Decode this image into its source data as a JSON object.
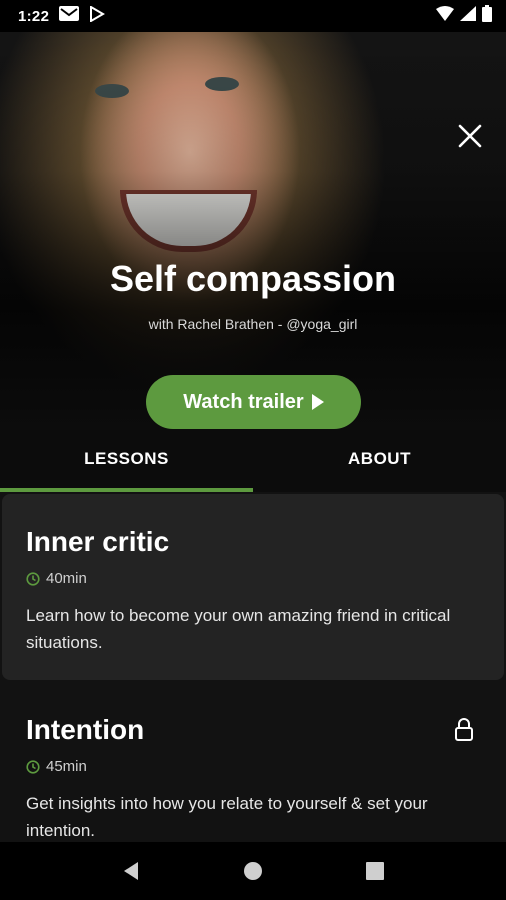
{
  "status_bar": {
    "time": "1:22",
    "left_icons": [
      "gmail-icon",
      "play-store-icon"
    ],
    "right_icons": [
      "wifi-icon",
      "signal-icon",
      "battery-icon"
    ]
  },
  "hero": {
    "title": "Self compassion",
    "subtitle": "with Rachel Brathen - @yoga_girl",
    "trailer_label": "Watch trailer",
    "close_icon": "close-icon"
  },
  "tabs": [
    {
      "label": "LESSONS",
      "selected": true
    },
    {
      "label": "ABOUT",
      "selected": false
    }
  ],
  "lessons": [
    {
      "title": "Inner critic",
      "duration": "40min",
      "description": "Learn how to become your own amazing friend in critical situations.",
      "locked": false
    },
    {
      "title": "Intention",
      "duration": "45min",
      "description": "Get insights into how you relate to yourself & set your intention.",
      "locked": true
    }
  ],
  "colors": {
    "accent": "#5d9a3f",
    "background": "#121212",
    "card": "#232323"
  },
  "nav_icons": [
    "back-icon",
    "home-icon",
    "recents-icon"
  ]
}
